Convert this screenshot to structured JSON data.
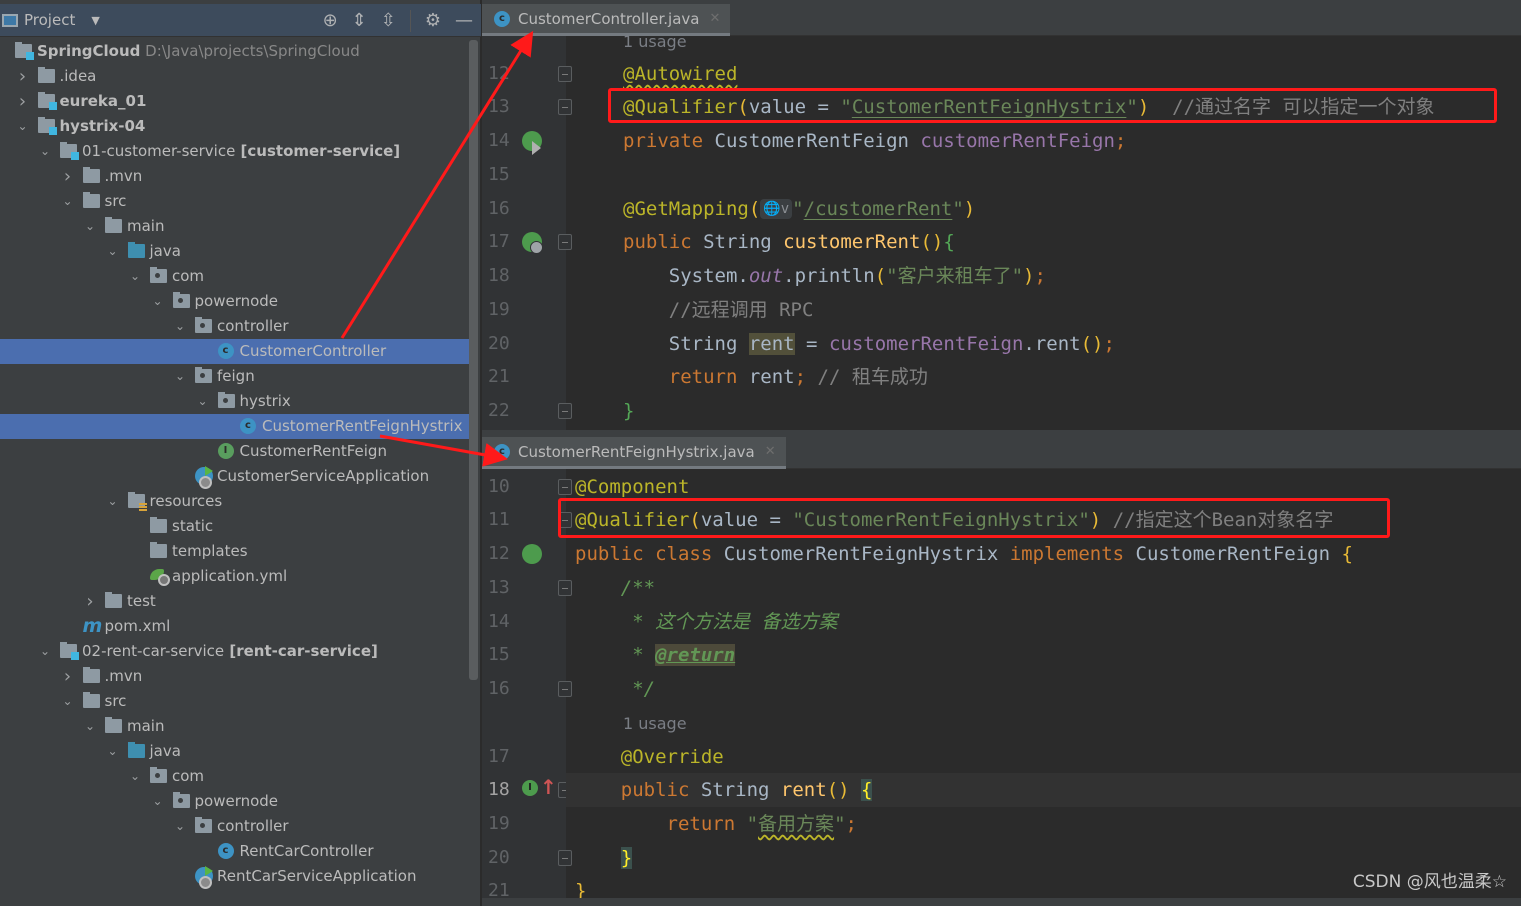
{
  "sidebar": {
    "title": "Project",
    "tools": [
      "locate-icon",
      "expand-all-icon",
      "collapse-all-icon",
      "gear-icon",
      "minimize-icon"
    ],
    "tree": [
      {
        "depth": 0,
        "arrow": "",
        "icon": "module",
        "label": "SpringCloud",
        "bold": true,
        "path": "D:\\Java\\projects\\SpringCloud"
      },
      {
        "depth": 1,
        "arrow": ">",
        "icon": "folder",
        "label": ".idea"
      },
      {
        "depth": 1,
        "arrow": ">",
        "icon": "module",
        "label": "eureka_01",
        "bold": true
      },
      {
        "depth": 1,
        "arrow": "v",
        "icon": "module",
        "label": "hystrix-04",
        "bold": true
      },
      {
        "depth": 2,
        "arrow": "v",
        "icon": "module",
        "label": "01-customer-service",
        "suffix": "[customer-service]"
      },
      {
        "depth": 3,
        "arrow": ">",
        "icon": "folder",
        "label": ".mvn"
      },
      {
        "depth": 3,
        "arrow": "v",
        "icon": "folder",
        "label": "src"
      },
      {
        "depth": 4,
        "arrow": "v",
        "icon": "folder",
        "label": "main"
      },
      {
        "depth": 5,
        "arrow": "v",
        "icon": "source",
        "label": "java"
      },
      {
        "depth": 6,
        "arrow": "v",
        "icon": "package",
        "label": "com"
      },
      {
        "depth": 7,
        "arrow": "v",
        "icon": "package",
        "label": "powernode"
      },
      {
        "depth": 8,
        "arrow": "v",
        "icon": "package",
        "label": "controller"
      },
      {
        "depth": 9,
        "arrow": "",
        "icon": "class",
        "label": "CustomerController",
        "selected": true
      },
      {
        "depth": 8,
        "arrow": "v",
        "icon": "package",
        "label": "feign"
      },
      {
        "depth": 9,
        "arrow": "v",
        "icon": "package",
        "label": "hystrix"
      },
      {
        "depth": 10,
        "arrow": "",
        "icon": "class",
        "label": "CustomerRentFeignHystrix",
        "selected": true
      },
      {
        "depth": 9,
        "arrow": "",
        "icon": "interface",
        "label": "CustomerRentFeign"
      },
      {
        "depth": 8,
        "arrow": "",
        "icon": "spring-app",
        "label": "CustomerServiceApplication"
      },
      {
        "depth": 5,
        "arrow": "v",
        "icon": "resources",
        "label": "resources"
      },
      {
        "depth": 6,
        "arrow": "",
        "icon": "folder",
        "label": "static"
      },
      {
        "depth": 6,
        "arrow": "",
        "icon": "folder",
        "label": "templates"
      },
      {
        "depth": 6,
        "arrow": "",
        "icon": "yml",
        "label": "application.yml"
      },
      {
        "depth": 4,
        "arrow": ">",
        "icon": "folder",
        "label": "test"
      },
      {
        "depth": 3,
        "arrow": "",
        "icon": "maven",
        "label": "pom.xml"
      },
      {
        "depth": 2,
        "arrow": "v",
        "icon": "module",
        "label": "02-rent-car-service",
        "suffix": "[rent-car-service]"
      },
      {
        "depth": 3,
        "arrow": ">",
        "icon": "folder",
        "label": ".mvn"
      },
      {
        "depth": 3,
        "arrow": "v",
        "icon": "folder",
        "label": "src"
      },
      {
        "depth": 4,
        "arrow": "v",
        "icon": "folder",
        "label": "main"
      },
      {
        "depth": 5,
        "arrow": "v",
        "icon": "source",
        "label": "java"
      },
      {
        "depth": 6,
        "arrow": "v",
        "icon": "package",
        "label": "com"
      },
      {
        "depth": 7,
        "arrow": "v",
        "icon": "package",
        "label": "powernode"
      },
      {
        "depth": 8,
        "arrow": "v",
        "icon": "package",
        "label": "controller"
      },
      {
        "depth": 9,
        "arrow": "",
        "icon": "class",
        "label": "RentCarController"
      },
      {
        "depth": 8,
        "arrow": "",
        "icon": "spring-app",
        "label": "RentCarServiceApplication"
      }
    ]
  },
  "editor1": {
    "tab": "CustomerController.java",
    "usage_hint": "1 usage",
    "lines": [
      {
        "n": "12",
        "segs": [
          [
            "ann squig",
            "@Autowired"
          ]
        ]
      },
      {
        "n": "13",
        "segs": [
          [
            "ann",
            "@Qualifier"
          ],
          [
            "brace",
            "("
          ],
          [
            "",
            "value = "
          ],
          [
            "str",
            "\""
          ],
          [
            "str und",
            "CustomerRentFeignHystrix"
          ],
          [
            "str",
            "\""
          ],
          [
            "brace",
            ")"
          ],
          [
            "",
            "  "
          ],
          [
            "cmt",
            "//通过名字 可以指定一个对象"
          ]
        ]
      },
      {
        "n": "14",
        "segs": [
          [
            "kw",
            "private "
          ],
          [
            "",
            "CustomerRentFeign "
          ],
          [
            "fld",
            "customerRentFeign"
          ],
          [
            "kw",
            ";"
          ]
        ]
      },
      {
        "n": "15",
        "segs": []
      },
      {
        "n": "16",
        "segs": [
          [
            "ann",
            "@GetMapping"
          ],
          [
            "brace",
            "("
          ],
          [
            "inlay",
            "🌐v"
          ],
          [
            "str",
            "\""
          ],
          [
            "str und",
            "/customerRent"
          ],
          [
            "str",
            "\""
          ],
          [
            "brace",
            ")"
          ]
        ]
      },
      {
        "n": "17",
        "segs": [
          [
            "kw",
            "public "
          ],
          [
            "",
            "String "
          ],
          [
            "fn",
            "customerRent"
          ],
          [
            "brace",
            "()"
          ],
          [
            "brace-g",
            "{"
          ]
        ]
      },
      {
        "n": "18",
        "segs": [
          [
            "",
            "    System."
          ],
          [
            "stat",
            "out"
          ],
          [
            "",
            ".println"
          ],
          [
            "brace",
            "("
          ],
          [
            "str",
            "\"客户来租车了\""
          ],
          [
            "brace",
            ")"
          ],
          [
            "kw",
            ";"
          ]
        ]
      },
      {
        "n": "19",
        "segs": [
          [
            "cmt",
            "    //远程调用 RPC"
          ]
        ]
      },
      {
        "n": "20",
        "segs": [
          [
            "",
            "    String "
          ],
          [
            "hl",
            "rent"
          ],
          [
            "",
            " = "
          ],
          [
            "fld",
            "customerRentFeign"
          ],
          [
            "",
            ".rent"
          ],
          [
            "brace",
            "()"
          ],
          [
            "kw",
            ";"
          ]
        ]
      },
      {
        "n": "21",
        "segs": [
          [
            "kw",
            "    return "
          ],
          [
            "",
            "rent"
          ],
          [
            "kw",
            "; "
          ],
          [
            "cmt",
            "// 租车成功"
          ]
        ]
      },
      {
        "n": "22",
        "segs": [
          [
            "brace-g",
            "}"
          ]
        ]
      }
    ]
  },
  "editor2": {
    "tab": "CustomerRentFeignHystrix.java",
    "usage_hint": "1 usage",
    "lines": [
      {
        "n": "10",
        "segs": [
          [
            "ann",
            "@Component"
          ]
        ]
      },
      {
        "n": "11",
        "segs": [
          [
            "ann",
            "@Qualifier"
          ],
          [
            "brace",
            "("
          ],
          [
            "",
            "value = "
          ],
          [
            "str",
            "\"CustomerRentFeignHystrix\""
          ],
          [
            "brace",
            ")"
          ],
          [
            "",
            " "
          ],
          [
            "cmt",
            "//指定这个Bean对象名字"
          ]
        ]
      },
      {
        "n": "12",
        "segs": [
          [
            "kw",
            "public class "
          ],
          [
            "",
            "CustomerRentFeignHystrix "
          ],
          [
            "kw",
            "implements "
          ],
          [
            "",
            "CustomerRentFeign "
          ],
          [
            "brace",
            "{"
          ]
        ]
      },
      {
        "n": "13",
        "segs": [
          [
            "doc",
            "    /**"
          ]
        ]
      },
      {
        "n": "14",
        "segs": [
          [
            "doc",
            "     * 这个方法是 备选方案"
          ]
        ]
      },
      {
        "n": "15",
        "segs": [
          [
            "doc",
            "     * "
          ],
          [
            "docTag",
            "@return"
          ]
        ]
      },
      {
        "n": "16",
        "segs": [
          [
            "doc",
            "     */"
          ]
        ]
      },
      {
        "n": "17",
        "segs": [
          [
            "ann",
            "    @Override"
          ]
        ]
      },
      {
        "n": "18",
        "segs": [
          [
            "kw",
            "    public "
          ],
          [
            "",
            "String "
          ],
          [
            "fn",
            "rent"
          ],
          [
            "brace",
            "() "
          ],
          [
            "brhl",
            "{"
          ]
        ]
      },
      {
        "n": "19",
        "segs": [
          [
            "kw",
            "        return "
          ],
          [
            "str",
            "\""
          ],
          [
            "str squig",
            "备用方案"
          ],
          [
            "str",
            "\""
          ],
          [
            "kw",
            ";"
          ]
        ]
      },
      {
        "n": "20",
        "segs": [
          [
            "",
            "    "
          ],
          [
            "brhl",
            "}"
          ]
        ]
      },
      {
        "n": "21",
        "segs": [
          [
            "brace",
            "}"
          ]
        ]
      }
    ]
  },
  "watermark": "CSDN @风也温柔☆",
  "colors": {
    "annotation_box": "#ff1a1a",
    "selection": "#4b6eaf",
    "editor_bg": "#2b2b2b"
  }
}
